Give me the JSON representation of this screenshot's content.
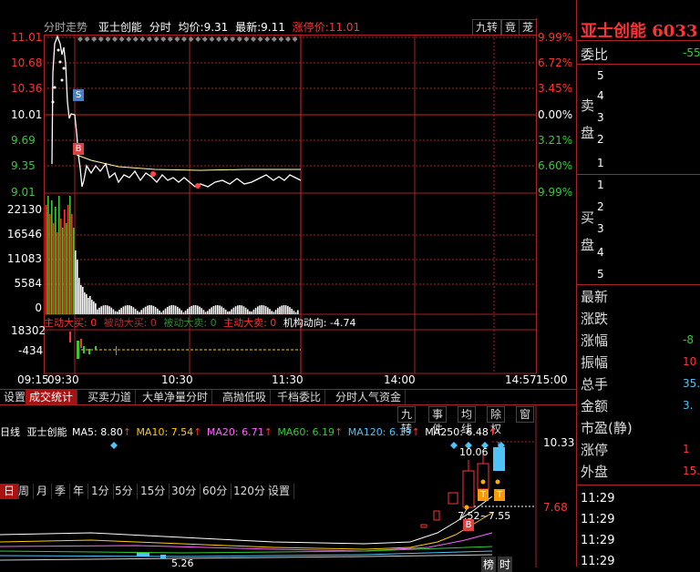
{
  "intraday": {
    "title": "分时走势",
    "stock_name": "亚士创能",
    "mode": "分时",
    "avg_label": "均价:",
    "avg_value": "9.31",
    "last_label": "最新:",
    "last_value": "9.11",
    "limit_label": "涨停价:",
    "limit_value": "11.01",
    "btn_jiuzhuan": "九转",
    "btn_jing": "竟",
    "btn_long": "茏",
    "price_ticks": [
      "11.01",
      "10.68",
      "10.36",
      "10.01",
      "9.69",
      "9.35",
      "9.01"
    ],
    "pct_ticks": [
      "9.99%",
      "6.72%",
      "3.45%",
      "0.00%",
      "3.21%",
      "6.60%",
      "9.99%"
    ],
    "vol_ticks": [
      "22130",
      "16546",
      "11083",
      "5584",
      "0"
    ],
    "flow_ticks": [
      "18302",
      "-434"
    ],
    "flow_labels": {
      "main_buy": "主动大买: 0",
      "passive_buy": "被动大买: 0",
      "passive_sell": "被动大卖: 0",
      "main_sell": "主动大卖: 0",
      "inst": "机构动向: -4.74"
    },
    "time_ticks": [
      "09:15",
      "09:30",
      "10:30",
      "11:30",
      "14:00",
      "14:57",
      "15:00"
    ],
    "markers": [
      "S",
      "B"
    ]
  },
  "tabs": [
    "设置",
    "成交统计",
    "买卖力道",
    "大单净量分时",
    "高抛低吸",
    "千档委比",
    "分时人气资金"
  ],
  "daily": {
    "label": "日线",
    "stock_name": "亚士创能",
    "ma5": "MA5: 8.80",
    "ma10": "MA10: 7.54",
    "ma20": "MA20: 6.71",
    "ma60": "MA60: 6.19",
    "ma120": "MA120: 6.19",
    "ma250": "MA250: 6.48",
    "btns": [
      "九转",
      "事件",
      "均线",
      "除权",
      "窗"
    ],
    "periods": [
      "日",
      "周",
      "月",
      "季",
      "年",
      "1分",
      "5分",
      "15分",
      "30分",
      "60分",
      "120分",
      "设置"
    ],
    "price_hi": "10.33",
    "price_lo": "7.68",
    "annot_hi": "10.06",
    "annot_range": "7.52~7.55",
    "annot_low": "5.26",
    "bottom_tags": [
      "榜",
      "时"
    ],
    "t_marks": [
      "T",
      "T"
    ],
    "b_mark": "B"
  },
  "right": {
    "name": "亚士创能 6033",
    "weibi_label": "委比",
    "weibi_value": "-55",
    "sell_label_1": "卖",
    "sell_label_2": "盘",
    "buy_label_1": "买",
    "buy_label_2": "盘",
    "sell_levels": [
      "5",
      "4",
      "3",
      "2",
      "1"
    ],
    "buy_levels": [
      "1",
      "2",
      "3",
      "4",
      "5"
    ],
    "stats": [
      {
        "label": "最新",
        "value": ""
      },
      {
        "label": "涨跌",
        "value": ""
      },
      {
        "label": "涨幅",
        "value": "-8"
      },
      {
        "label": "振幅",
        "value": "10"
      },
      {
        "label": "总手",
        "value": "35."
      },
      {
        "label": "金额",
        "value": "3."
      },
      {
        "label": "市盈(静)",
        "value": ""
      },
      {
        "label": "涨停",
        "value": "1"
      },
      {
        "label": "外盘",
        "value": "15."
      }
    ],
    "times": [
      "11:29",
      "11:29",
      "11:29",
      "11:29"
    ]
  },
  "colors": {
    "up": "#ff3333",
    "down": "#33cc33",
    "grid": "#aa2222",
    "cyan": "#4fc3f7"
  }
}
